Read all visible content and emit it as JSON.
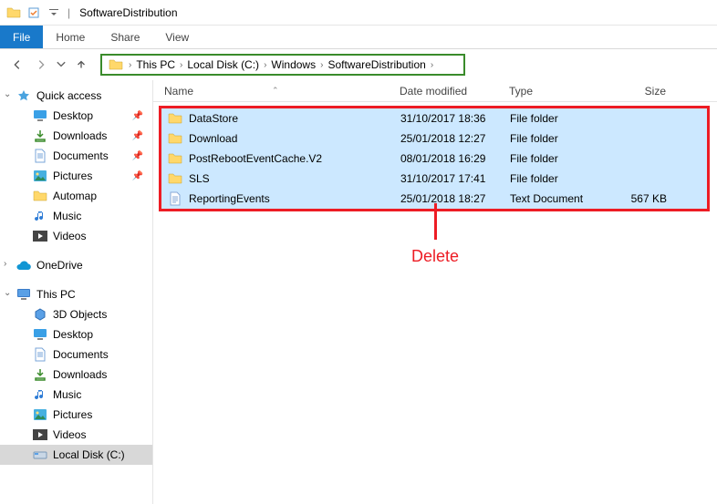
{
  "titlebar": {
    "title": "SoftwareDistribution"
  },
  "ribbon": {
    "file": "File",
    "home": "Home",
    "share": "Share",
    "view": "View"
  },
  "breadcrumb": [
    "This PC",
    "Local Disk (C:)",
    "Windows",
    "SoftwareDistribution"
  ],
  "columns": {
    "name": "Name",
    "date": "Date modified",
    "type": "Type",
    "size": "Size"
  },
  "sidebar": {
    "quick": {
      "label": "Quick access",
      "items": [
        {
          "label": "Desktop",
          "pinned": true,
          "icon": "desktop"
        },
        {
          "label": "Downloads",
          "pinned": true,
          "icon": "downloads"
        },
        {
          "label": "Documents",
          "pinned": true,
          "icon": "documents"
        },
        {
          "label": "Pictures",
          "pinned": true,
          "icon": "pictures"
        },
        {
          "label": "Automap",
          "pinned": false,
          "icon": "folder"
        },
        {
          "label": "Music",
          "pinned": false,
          "icon": "music"
        },
        {
          "label": "Videos",
          "pinned": false,
          "icon": "videos"
        }
      ]
    },
    "onedrive": {
      "label": "OneDrive"
    },
    "thispc": {
      "label": "This PC",
      "items": [
        {
          "label": "3D Objects",
          "icon": "3d"
        },
        {
          "label": "Desktop",
          "icon": "desktop"
        },
        {
          "label": "Documents",
          "icon": "documents"
        },
        {
          "label": "Downloads",
          "icon": "downloads"
        },
        {
          "label": "Music",
          "icon": "music"
        },
        {
          "label": "Pictures",
          "icon": "pictures"
        },
        {
          "label": "Videos",
          "icon": "videos"
        },
        {
          "label": "Local Disk (C:)",
          "icon": "drive",
          "selected": true
        }
      ]
    }
  },
  "files": [
    {
      "name": "DataStore",
      "date": "31/10/2017 18:36",
      "type": "File folder",
      "size": "",
      "icon": "folder"
    },
    {
      "name": "Download",
      "date": "25/01/2018 12:27",
      "type": "File folder",
      "size": "",
      "icon": "folder"
    },
    {
      "name": "PostRebootEventCache.V2",
      "date": "08/01/2018 16:29",
      "type": "File folder",
      "size": "",
      "icon": "folder"
    },
    {
      "name": "SLS",
      "date": "31/10/2017 17:41",
      "type": "File folder",
      "size": "",
      "icon": "folder"
    },
    {
      "name": "ReportingEvents",
      "date": "25/01/2018 18:27",
      "type": "Text Document",
      "size": "567 KB",
      "icon": "doc"
    }
  ],
  "annotation": {
    "delete": "Delete"
  }
}
